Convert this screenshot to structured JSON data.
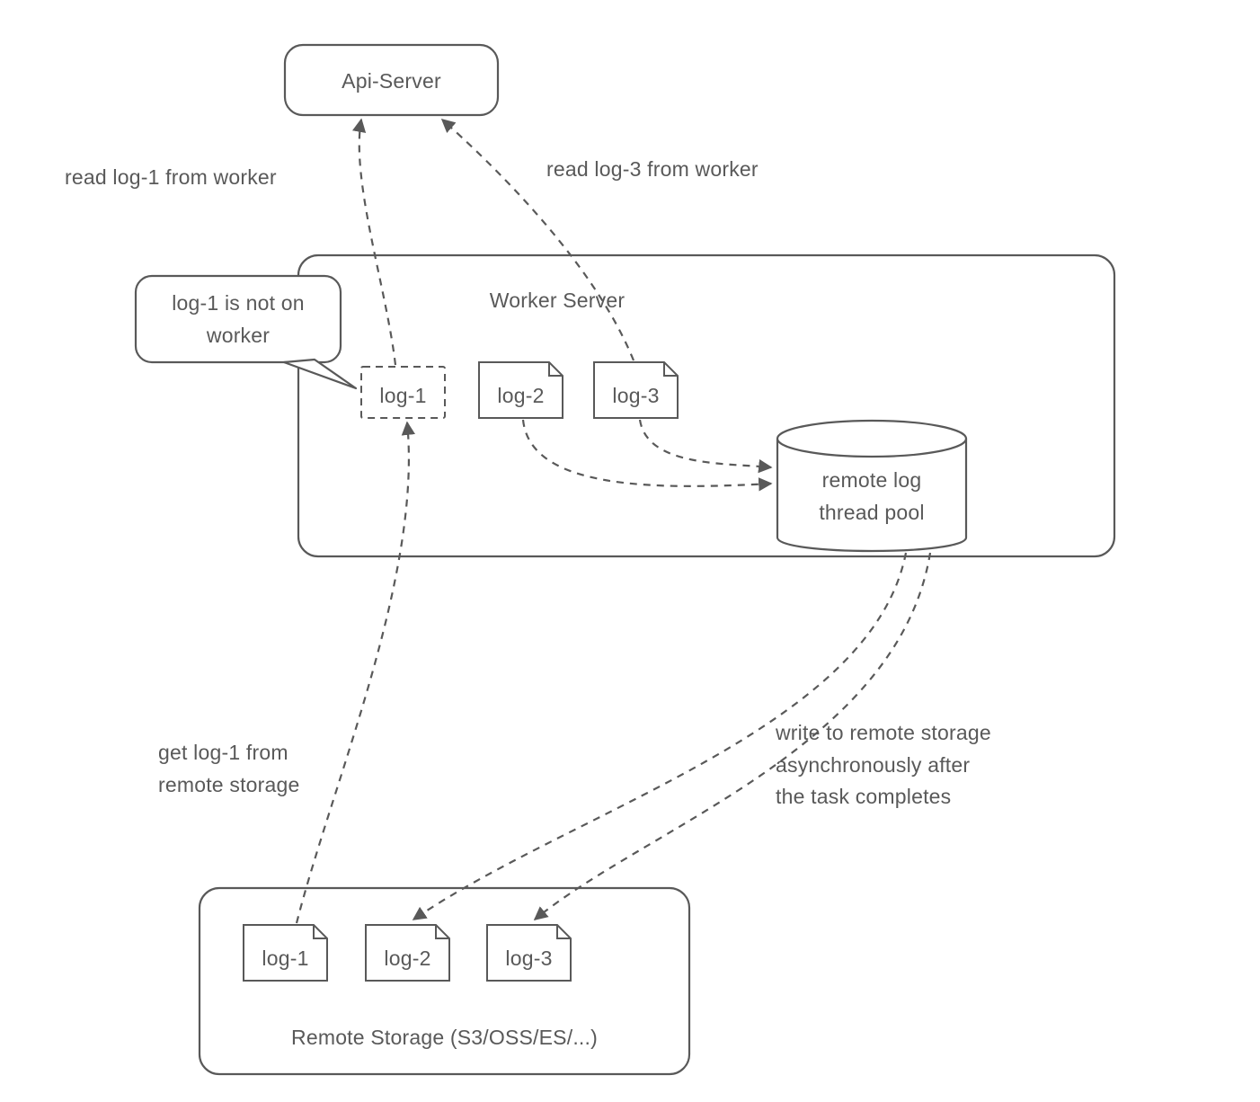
{
  "colors": {
    "stroke": "#595959",
    "bg": "#ffffff",
    "text": "#595959"
  },
  "nodes": {
    "api_server": "Api-Server",
    "worker_server_title": "Worker Server",
    "thread_pool": "remote log\nthread pool",
    "remote_storage_title": "Remote Storage (S3/OSS/ES/...)",
    "callout_log1": "log-1 is not on\nworker"
  },
  "files": {
    "worker": {
      "log1": "log-1",
      "log2": "log-2",
      "log3": "log-3"
    },
    "remote": {
      "log1": "log-1",
      "log2": "log-2",
      "log3": "log-3"
    }
  },
  "edges": {
    "read_log1": "read log-1 from worker",
    "read_log3": "read log-3 from worker",
    "get_log1": "get log-1 from\nremote storage",
    "write_async": "write to remote storage\nasynchronously after\nthe task completes"
  }
}
